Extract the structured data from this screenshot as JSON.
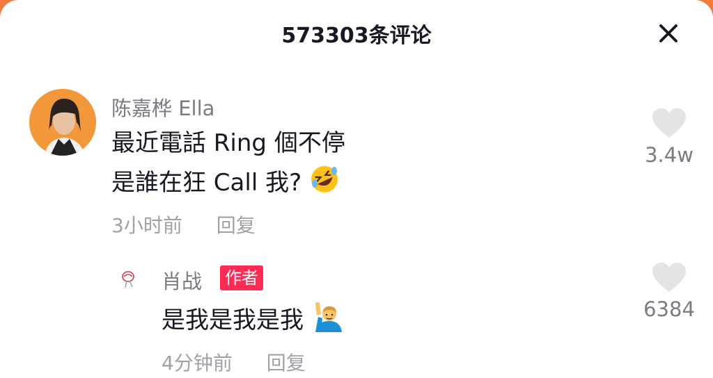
{
  "header": {
    "title": "573303条评论"
  },
  "comments": [
    {
      "user": "陈嘉桦 Ella",
      "lines": [
        "最近電話 Ring 個不停",
        "是誰在狂 Call 我?"
      ],
      "time": "3小时前",
      "reply_label": "回复",
      "likes": "3.4w",
      "emoji": "rolling-on-floor-laughing"
    }
  ],
  "replies": [
    {
      "user": "肖战",
      "badge": "作者",
      "text": "是我是我是我",
      "time": "4分钟前",
      "reply_label": "回复",
      "likes": "6384",
      "emoji": "person-raising-hand"
    }
  ],
  "colors": {
    "accent": "#fe2c55",
    "background_outer": "#f07a3a",
    "text_primary": "#161823",
    "text_secondary": "#7b7c83",
    "text_meta": "#a0a1a7",
    "like_icon": "#e4e4e6"
  }
}
